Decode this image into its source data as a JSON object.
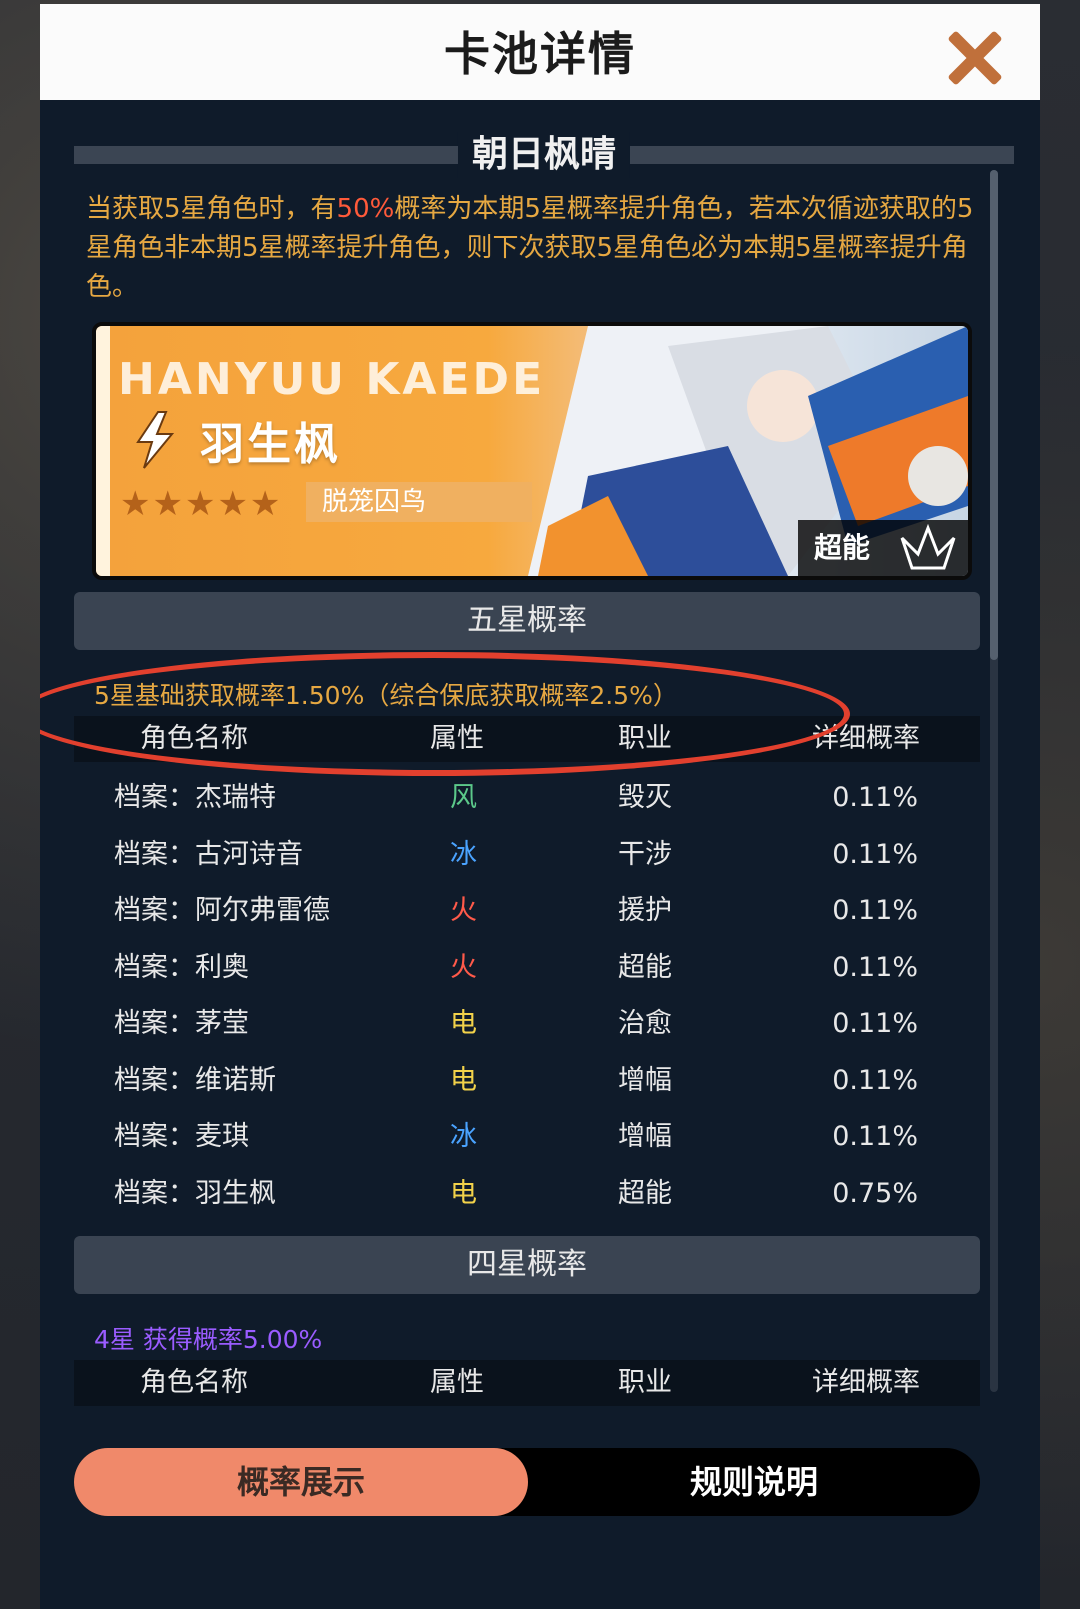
{
  "dialog": {
    "title": "卡池详情",
    "pool_name": "朝日枫晴",
    "notice_prefix": "当获取5星角色时，有",
    "notice_highlight": "50%",
    "notice_suffix": "概率为本期5星概率提升角色，若本次循迹获取的5星角色非本期5星概率提升角色，则下次获取5星角色必为本期5星概率提升角色。"
  },
  "banner": {
    "english_name": "HANYUU KAEDE",
    "character_name": "羽生枫",
    "stars": "★★★★★",
    "tag": "脱笼囚鸟",
    "class_label": "超能"
  },
  "five_star": {
    "section_label": "五星概率",
    "rate_text": "5星基础获取概率1.50%（综合保底获取概率2.5%）",
    "headers": {
      "name": "角色名称",
      "attr": "属性",
      "job": "职业",
      "rate": "详细概率"
    },
    "rows": [
      {
        "name": "档案：杰瑞特",
        "attr": "风",
        "attr_color": "#5cc98a",
        "job": "毁灭",
        "rate": "0.11%"
      },
      {
        "name": "档案：古河诗音",
        "attr": "冰",
        "attr_color": "#4aa3ff",
        "job": "干涉",
        "rate": "0.11%"
      },
      {
        "name": "档案：阿尔弗雷德",
        "attr": "火",
        "attr_color": "#ff5a4a",
        "job": "援护",
        "rate": "0.11%"
      },
      {
        "name": "档案：利奥",
        "attr": "火",
        "attr_color": "#ff5a4a",
        "job": "超能",
        "rate": "0.11%"
      },
      {
        "name": "档案：茅莹",
        "attr": "电",
        "attr_color": "#f2d24a",
        "job": "治愈",
        "rate": "0.11%"
      },
      {
        "name": "档案：维诺斯",
        "attr": "电",
        "attr_color": "#f2d24a",
        "job": "增幅",
        "rate": "0.11%"
      },
      {
        "name": "档案：麦琪",
        "attr": "冰",
        "attr_color": "#4aa3ff",
        "job": "增幅",
        "rate": "0.11%"
      },
      {
        "name": "档案：羽生枫",
        "attr": "电",
        "attr_color": "#f2d24a",
        "job": "超能",
        "rate": "0.75%"
      }
    ]
  },
  "four_star": {
    "section_label": "四星概率",
    "rate_text": "4星 获得概率5.00%",
    "headers": {
      "name": "角色名称",
      "attr": "属性",
      "job": "职业",
      "rate": "详细概率"
    }
  },
  "tabs": {
    "active": "概率展示",
    "inactive": "规则说明"
  },
  "colors": {
    "accent_orange": "#e6a842",
    "highlight_red": "#ff5a3a",
    "four_star_purple": "#9a5cff",
    "tab_active": "#f0896a",
    "annotation_red": "#e2402e"
  },
  "icons": [
    "close-icon",
    "lightning-icon",
    "star-icon",
    "class-emblem-icon"
  ]
}
